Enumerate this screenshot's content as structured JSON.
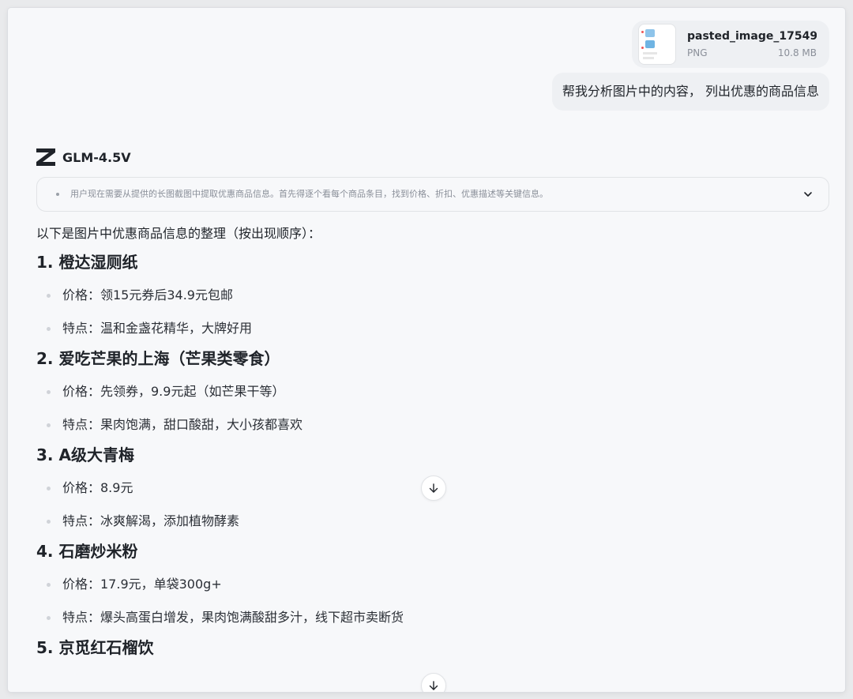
{
  "attachment": {
    "name": "pasted_image_17549...",
    "type": "PNG",
    "size": "10.8 MB",
    "icon": "image-file-thumbnail"
  },
  "user_message": "帮我分析图片中的内容， 列出优惠的商品信息",
  "model": {
    "name": "GLM-4.5V",
    "logo_icon": "z-logo-icon"
  },
  "thinking": {
    "text": "用户现在需要从提供的长图截图中提取优惠商品信息。首先得逐个看每个商品条目，找到价格、折扣、优惠描述等关键信息。",
    "expand_icon": "chevron-down-icon"
  },
  "response": {
    "intro": "以下是图片中优惠商品信息的整理（按出现顺序）：",
    "items": [
      {
        "title": "1. 橙达湿厕纸",
        "price": "价格：领15元券后34.9元包邮",
        "feature": "特点：温和金盏花精华，大牌好用"
      },
      {
        "title": "2. 爱吃芒果的上海（芒果类零食）",
        "price": "价格：先领券，9.9元起（如芒果干等）",
        "feature": "特点：果肉饱满，甜口酸甜，大小孩都喜欢"
      },
      {
        "title": "3. A级大青梅",
        "price": "价格：8.9元",
        "feature": "特点：冰爽解渴，添加植物酵素"
      },
      {
        "title": "4. 石磨炒米粉",
        "price": "价格：17.9元，单袋300g+",
        "feature": "特点：爆头高蛋白增发，果肉饱满酸甜多汁，线下超市卖断货"
      },
      {
        "title": "5. 京觅红石榴饮"
      }
    ]
  },
  "scroll_button_icon": "arrow-down-icon",
  "colors": {
    "bubble_bg": "#eef0f3",
    "page_bg": "#f7f8fa",
    "text": "#1f2329",
    "muted": "#8a8f99"
  }
}
